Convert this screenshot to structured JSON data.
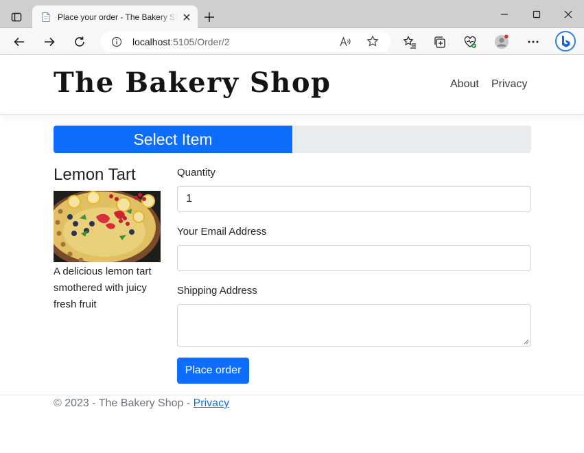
{
  "browser": {
    "tab_title": "Place your order - The Bakery Shop",
    "url_host": "localhost",
    "url_rest": ":5105/Order/2",
    "icons": [
      "tab-actions-icon",
      "page-favicon-icon",
      "close-tab-icon",
      "new-tab-icon",
      "minimize-icon",
      "maximize-icon",
      "close-window-icon",
      "back-icon",
      "forward-icon",
      "refresh-icon",
      "site-info-icon",
      "read-aloud-icon",
      "favorite-star-icon",
      "favorites-icon",
      "collections-icon",
      "browser-essentials-icon",
      "profile-avatar-icon",
      "more-menu-icon",
      "bing-copilot-icon"
    ]
  },
  "header": {
    "brand": "The Bakery Shop",
    "nav": {
      "about": "About",
      "privacy": "Privacy"
    }
  },
  "progress": {
    "label": "Select Item",
    "fraction": 0.5,
    "color": "#0d6efd"
  },
  "item": {
    "title": "Lemon Tart",
    "description": "A delicious lemon tart smothered with juicy fresh fruit"
  },
  "form": {
    "quantity_label": "Quantity",
    "quantity_value": "1",
    "email_label": "Your Email Address",
    "email_value": "",
    "shipping_label": "Shipping Address",
    "shipping_value": "",
    "submit_label": "Place order"
  },
  "footer": {
    "text": "© 2023 - The Bakery Shop - ",
    "privacy_link": "Privacy"
  },
  "colors": {
    "primary": "#0d6efd",
    "track": "#e9ecef",
    "muted": "#6c757d"
  }
}
